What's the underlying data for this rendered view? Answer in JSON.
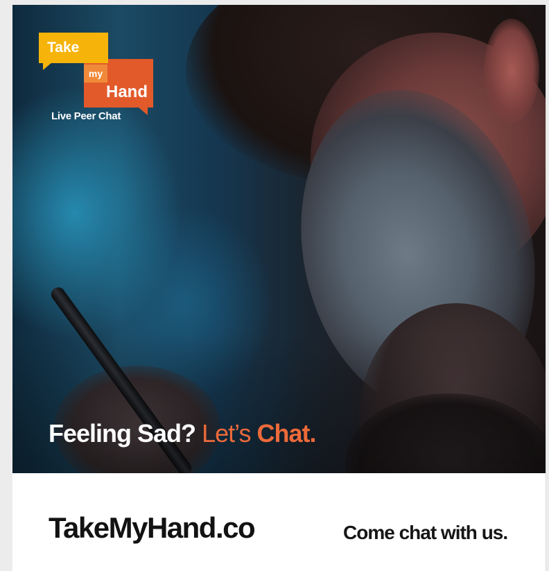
{
  "logo": {
    "word_take": "Take",
    "word_my": "my",
    "word_hand": "Hand",
    "tagline": "Live Peer Chat",
    "colors": {
      "yellow": "#f6b40b",
      "orange": "#e25a2a",
      "light_orange": "#f08a3a"
    }
  },
  "headline": {
    "part1": "Feeling Sad?",
    "part2": "Let’s",
    "part3": "Chat.",
    "accent_color": "#ec6a3a"
  },
  "footer": {
    "website": "TakeMyHand.co",
    "cta": "Come chat with us."
  }
}
